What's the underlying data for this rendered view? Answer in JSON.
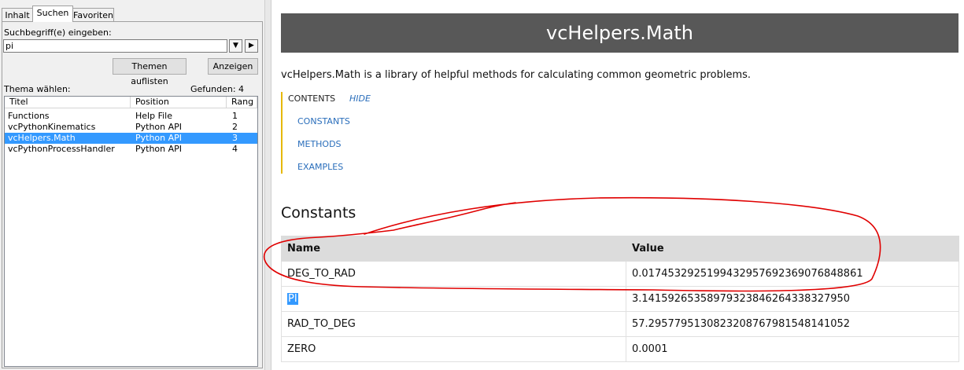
{
  "help_pane": {
    "tabs": [
      "Inhalt",
      "Suchen",
      "Favoriten"
    ],
    "active_tab": "Suchen",
    "search_label": "Suchbegriff(e) eingeben:",
    "search_value": "pi",
    "list_topics_button": "Themen auflisten",
    "display_button": "Anzeigen",
    "choose_topic_label": "Thema wählen:",
    "found_label": "Gefunden: 4",
    "columns": [
      "Titel",
      "Position",
      "Rang"
    ],
    "results": [
      {
        "title": "Functions",
        "position": "Help File",
        "rank": "1"
      },
      {
        "title": "vcPythonKinematics",
        "position": "Python API",
        "rank": "2"
      },
      {
        "title": "vcHelpers.Math",
        "position": "Python API",
        "rank": "3"
      },
      {
        "title": "vcPythonProcessHandler",
        "position": "Python API",
        "rank": "4"
      }
    ],
    "selected_index": 2
  },
  "page": {
    "title": "vcHelpers.Math",
    "intro": "vcHelpers.Math is a library of helpful methods for calculating common geometric problems.",
    "toc": {
      "heading": "CONTENTS",
      "hide_label": "HIDE",
      "links": [
        "CONSTANTS",
        "METHODS",
        "EXAMPLES"
      ]
    },
    "constants_heading": "Constants",
    "table": {
      "headers": [
        "Name",
        "Value"
      ],
      "rows": [
        {
          "name": "DEG_TO_RAD",
          "value": "0.0174532925199432957692369076848861"
        },
        {
          "name": "PI",
          "value": "3.14159265358979323846264338327950"
        },
        {
          "name": "RAD_TO_DEG",
          "value": "57.2957795130823208767981548141052"
        },
        {
          "name": "ZERO",
          "value": "0.0001"
        }
      ]
    }
  },
  "colors": {
    "title_bar": "#585858",
    "link": "#2a6ebb",
    "toc_border": "#e6b800",
    "selection": "#3399ff",
    "annotation": "#e00000"
  }
}
